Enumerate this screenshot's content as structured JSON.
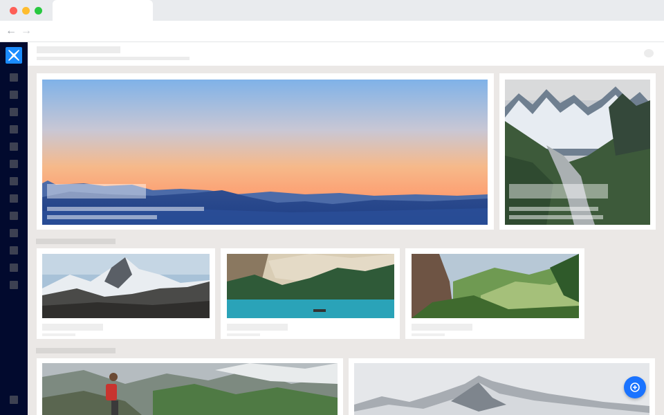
{
  "browser": {
    "window_controls": [
      "close",
      "minimize",
      "maximize"
    ],
    "nav": {
      "back_icon": "arrow-left-icon",
      "forward_icon": "arrow-right-icon"
    }
  },
  "sidebar": {
    "logo_icon": "x-logo-icon",
    "logo_color": "#1b8cff",
    "background": "#020a2e",
    "item_count": 13
  },
  "colors": {
    "accent": "#1a73ff",
    "content_bg": "#ebe8e6"
  },
  "sections": [
    {
      "name": "featured",
      "cards": [
        "sunset-mountain-range",
        "snowy-alpine-glacier"
      ]
    },
    {
      "name": "row-2",
      "cards": [
        "snow-capped-peak",
        "turquoise-lake-boat",
        "green-valley-cliff"
      ]
    },
    {
      "name": "row-3",
      "cards": [
        "hiker-on-ridge",
        "snowy-mountain-ridge"
      ]
    }
  ],
  "fab": {
    "icon": "add-circle-icon"
  }
}
